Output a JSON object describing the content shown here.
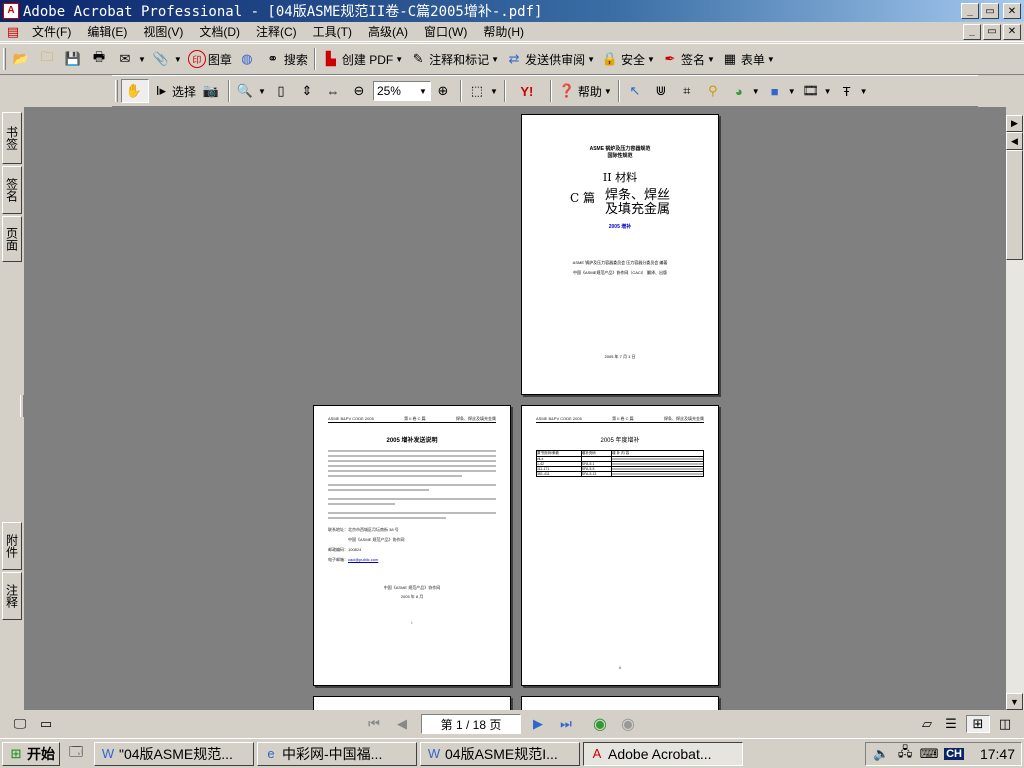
{
  "window": {
    "title": "Adobe Acrobat Professional - [04版ASME规范II卷-C篇2005增补-.pdf]",
    "min": "_",
    "max": "▭",
    "close": "✕"
  },
  "menu": [
    "文件(F)",
    "编辑(E)",
    "视图(V)",
    "文档(D)",
    "注释(C)",
    "工具(T)",
    "高级(A)",
    "窗口(W)",
    "帮助(H)"
  ],
  "toolbar1": {
    "stamp": "图章",
    "search": "搜索",
    "create_pdf": "创建 PDF",
    "comment": "注释和标记",
    "review": "发送供审阅",
    "security": "安全",
    "sign": "签名",
    "forms": "表单"
  },
  "toolbar2": {
    "select": "选择",
    "zoom": "25%",
    "help": "帮助"
  },
  "left_tabs": {
    "bookmarks": "书签",
    "signatures": "签名",
    "pages": "页面",
    "attachments": "附件",
    "comments": "注释"
  },
  "pages": {
    "cover": {
      "header1": "ASME 锅炉及压力容器规范",
      "header2": "国际性规范",
      "vol": "II 材料",
      "part": "C 篇",
      "title1": "焊条、焊丝",
      "title2": "及填充金属",
      "addenda": "2005 增补",
      "pub1": "ASME 锅炉及压力容器委员会 压力容器分委员会   编著",
      "pub2": "中国《ASME规范产品》协作网（CACI）  翻译、出版",
      "date": "2005 年 7 月 1 日"
    },
    "p2": {
      "hdr_left": "ASME B&PV CODE 2005",
      "hdr_mid": "第 II 卷 C 篇",
      "hdr_right": "焊条、焊丝及填充金属",
      "title": "2005 增补发送说明",
      "contact_label": "联系地址：北京市西城区月坛南街 38 号",
      "org": "中国《ASME 规范产品》协作网",
      "post": "邮政编码：100824",
      "email_label": "电子邮箱：",
      "email": "caci@public.com",
      "sign": "中国《ASME 规范产品》协作网",
      "sign_date": "2005 年 8 月",
      "num": "i"
    },
    "p3": {
      "hdr_left": "ASME B&PV CODE 2005",
      "hdr_mid": "第 II 卷 C 篇",
      "hdr_right": "焊条、焊丝及填充金属",
      "title": "2005 年度增补",
      "col1": "原书页码/条款",
      "col2": "增补页码",
      "col3": "增 补 内 容",
      "rows": [
        [
          "vii-x",
          "",
          ""
        ],
        [
          "1-42",
          "SFA-5.1",
          ""
        ],
        [
          "111-171",
          "SFA-5.5",
          ""
        ],
        [
          "351-411",
          "SFA-5.13",
          ""
        ]
      ],
      "num": "ii"
    }
  },
  "nav": {
    "page_info": "第 1 / 18 页"
  },
  "taskbar": {
    "start": "开始",
    "tasks": [
      "\"04版ASME规范...",
      "中彩网-中国福...",
      "04版ASME规范I...",
      "Adobe Acrobat..."
    ],
    "lang": "CH",
    "clock": "17:47"
  },
  "colors": {
    "title_start": "#0a246a",
    "title_end": "#a6caf0",
    "doc_bg": "#808080",
    "chrome": "#d4d0c8",
    "acrobat_red": "#cc0000"
  }
}
